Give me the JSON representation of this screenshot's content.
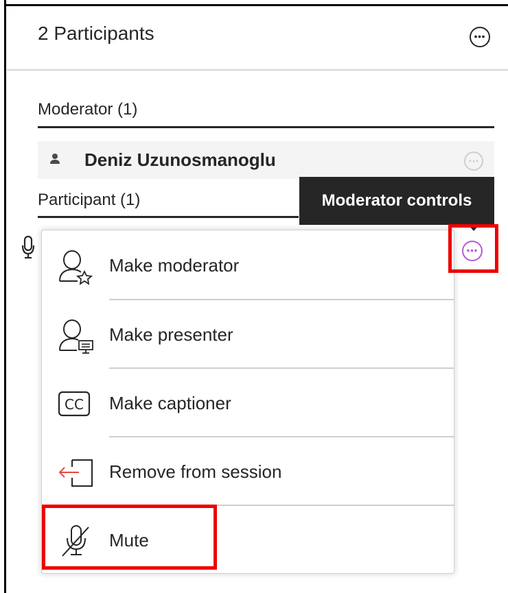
{
  "panel": {
    "title": "2 Participants",
    "more_icon": "more-options-icon"
  },
  "moderator_section": {
    "title": "Moderator (1)",
    "members": [
      {
        "name": "Deniz Uzunosmanoglu",
        "icon": "person-icon"
      }
    ]
  },
  "participant_section": {
    "title": "Participant (1)",
    "mic_icon": "microphone-icon"
  },
  "tooltip": {
    "text": "Moderator controls"
  },
  "menu": {
    "items": [
      {
        "label": "Make moderator",
        "icon": "user-star-icon"
      },
      {
        "label": "Make presenter",
        "icon": "user-presenter-icon"
      },
      {
        "label": "Make captioner",
        "icon": "closed-caption-icon",
        "icon_text": "CC"
      },
      {
        "label": "Remove from session",
        "icon": "remove-exit-icon"
      },
      {
        "label": "Mute",
        "icon": "mic-muted-icon"
      }
    ]
  },
  "colors": {
    "accent": "#b558d8",
    "highlight": "#ee0000",
    "remove_arrow": "#e8473f",
    "text": "#262626"
  }
}
